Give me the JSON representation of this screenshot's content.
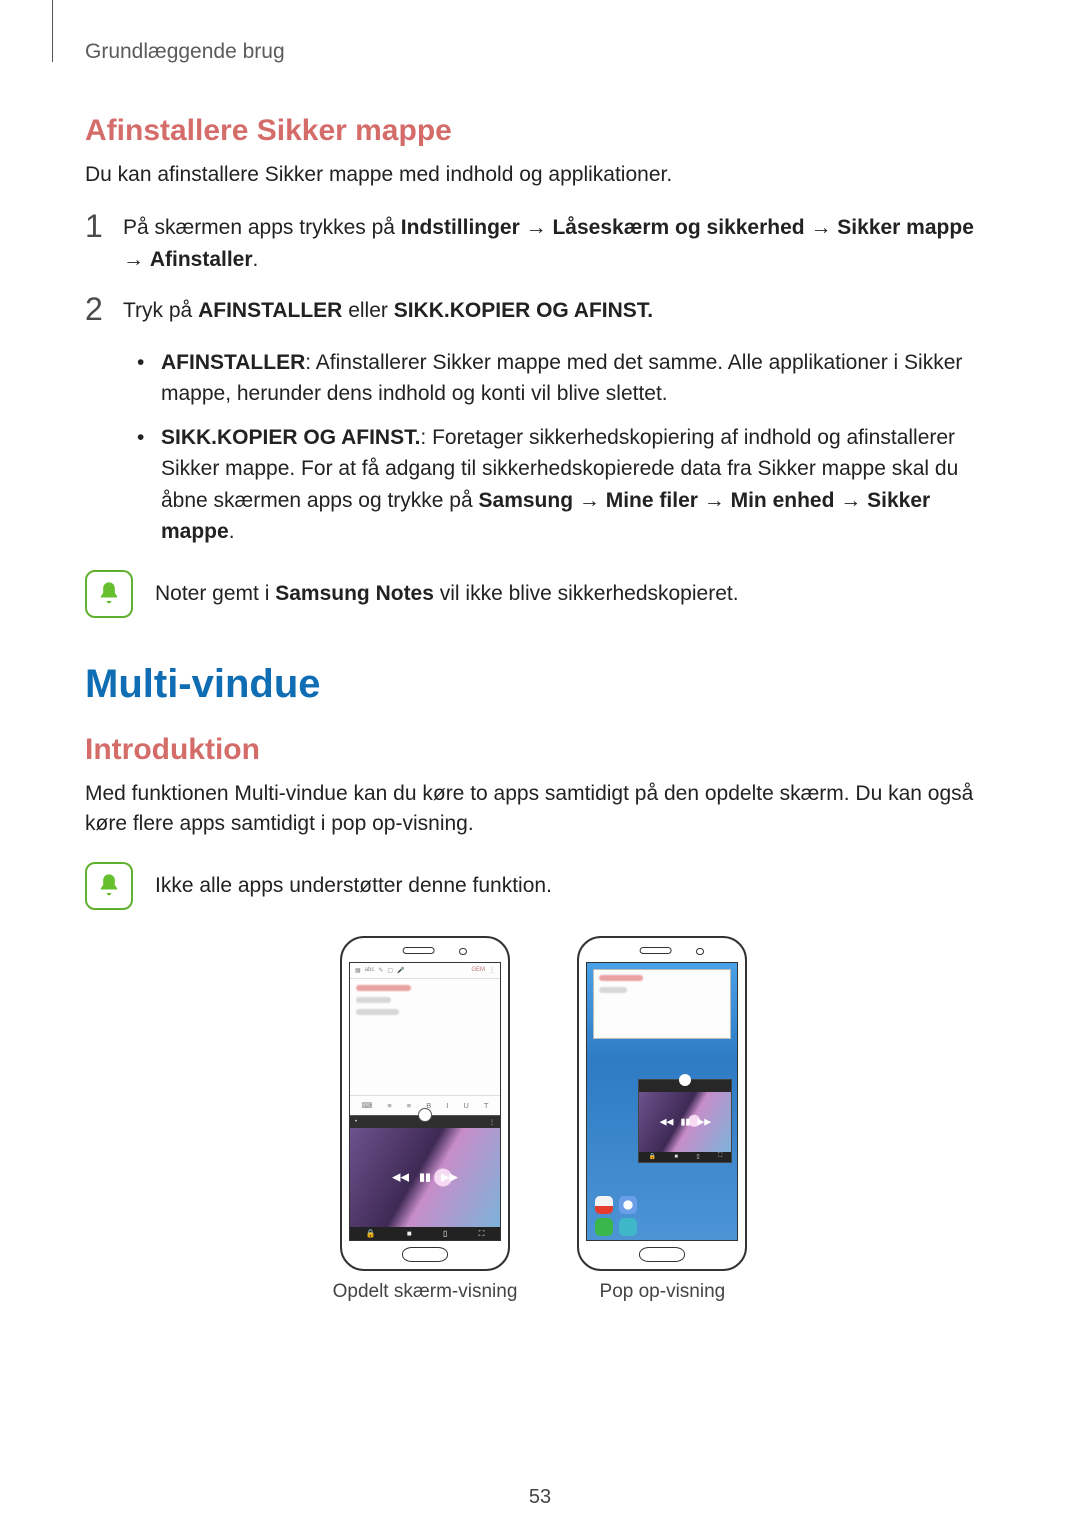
{
  "breadcrumb": "Grundlæggende brug",
  "section1": {
    "heading": "Afinstallere Sikker mappe",
    "intro": "Du kan afinstallere Sikker mappe med indhold og applikationer.",
    "step1": {
      "num": "1",
      "pre": "På skærmen apps trykkes på ",
      "path1": "Indstillinger",
      "path2": "Låseskærm og sikkerhed",
      "path3": "Sikker mappe",
      "path4": "Afinstaller",
      "arrow": "→",
      "end": "."
    },
    "step2": {
      "num": "2",
      "pre": "Tryk på ",
      "b1": "AFINSTALLER",
      "mid": " eller ",
      "b2": "SIKK.KOPIER OG AFINST."
    },
    "bullet1": {
      "lead": "AFINSTALLER",
      "text": ": Afinstallerer Sikker mappe med det samme. Alle applikationer i Sikker mappe, herunder dens indhold og konti vil blive slettet."
    },
    "bullet2": {
      "lead": "SIKK.KOPIER OG AFINST.",
      "text_a": ": Foretager sikkerhedskopiering af indhold og afinstallerer Sikker mappe. For at få adgang til sikkerhedskopierede data fra Sikker mappe skal du åbne skærmen apps og trykke på ",
      "p1": "Samsung",
      "p2": "Mine filer",
      "p3": "Min enhed",
      "p4": "Sikker mappe",
      "arrow": "→",
      "end": "."
    },
    "note_pre": "Noter gemt i ",
    "note_bold": "Samsung Notes",
    "note_post": " vil ikke blive sikkerhedskopieret."
  },
  "section2": {
    "title": "Multi-vindue",
    "sub": "Introduktion",
    "para": "Med funktionen Multi-vindue kan du køre to apps samtidigt på den opdelte skærm. Du kan også køre flere apps samtidigt i pop op-visning.",
    "note": "Ikke alle apps understøtter denne funktion."
  },
  "figures": {
    "caption1": "Opdelt skærm-visning",
    "caption2": "Pop op-visning"
  },
  "page_number": "53",
  "toolbar_items": {
    "i1": "▦",
    "i2": "abc",
    "i3": "✎",
    "i4": "▢",
    "i5": "🎤",
    "save": "GEM",
    "more": "⋮"
  },
  "fmt_bar": {
    "a": "⌨",
    "b": "≡",
    "c": "≡",
    "d": "B",
    "e": "I",
    "f": "U",
    "g": "T"
  }
}
